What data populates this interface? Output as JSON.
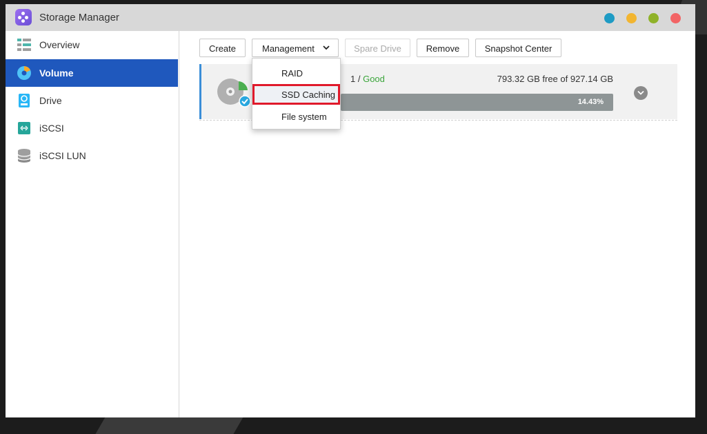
{
  "window": {
    "title": "Storage Manager",
    "buttons": [
      "blue",
      "yellow",
      "green",
      "red"
    ]
  },
  "sidebar": {
    "items": [
      {
        "label": "Overview",
        "icon": "overview-icon",
        "active": false
      },
      {
        "label": "Volume",
        "icon": "volume-icon",
        "active": true
      },
      {
        "label": "Drive",
        "icon": "drive-icon",
        "active": false
      },
      {
        "label": "iSCSI",
        "icon": "iscsi-icon",
        "active": false
      },
      {
        "label": "iSCSI LUN",
        "icon": "iscsi-lun-icon",
        "active": false
      }
    ]
  },
  "toolbar": {
    "create": "Create",
    "management": "Management",
    "spare_drive": "Spare Drive",
    "remove": "Remove",
    "snapshot_center": "Snapshot Center"
  },
  "management_menu": {
    "items": [
      "RAID",
      "SSD Caching",
      "File system"
    ],
    "highlighted": "SSD Caching"
  },
  "volume": {
    "status_prefix": "1 /",
    "status": "Good",
    "free_text": "793.32 GB free of 927.14 GB",
    "used_percent_label": "14.43%",
    "used_fraction": 0.1443
  },
  "colors": {
    "accent": "#1f58bd",
    "good": "#3aa53a",
    "highlight_border": "#e0192a"
  }
}
